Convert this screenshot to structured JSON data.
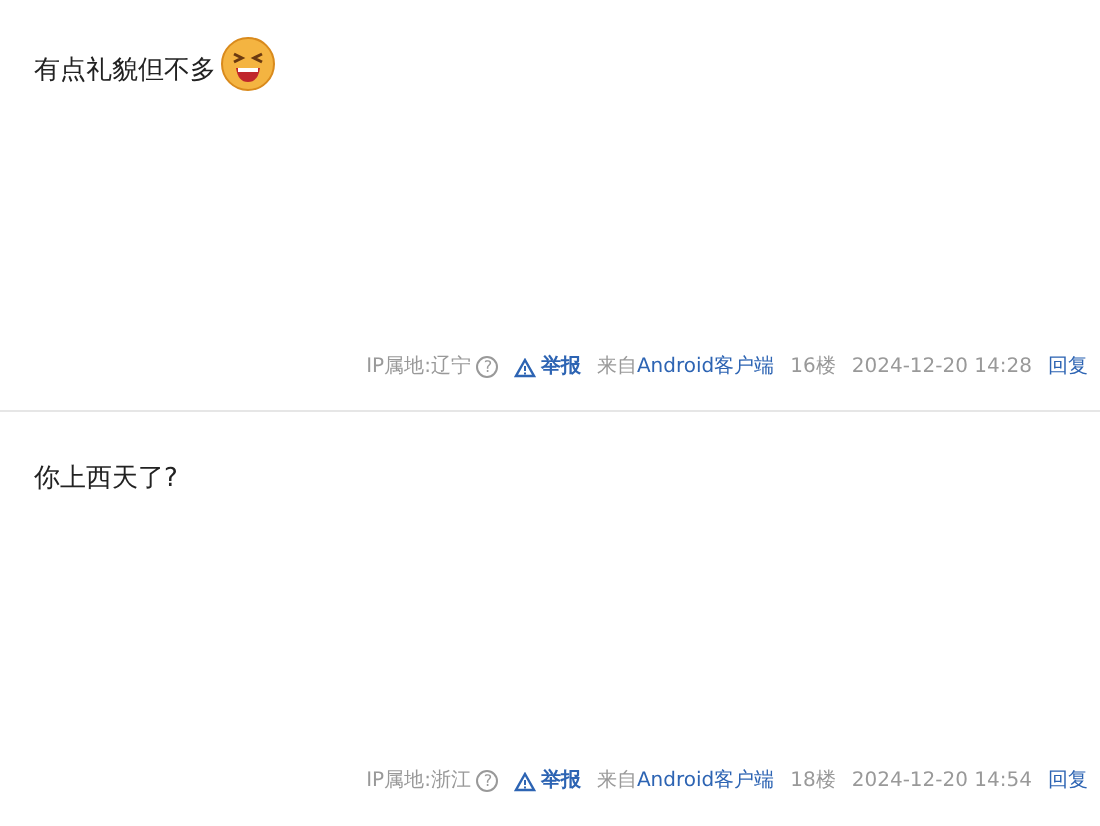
{
  "posts": [
    {
      "content": "有点礼貌但不多",
      "emoji": true,
      "ip_location": "IP属地:辽宁",
      "help": "?",
      "report": "举报",
      "source_prefix": "来自",
      "source_link": "Android客户端",
      "floor": "16楼",
      "time": "2024-12-20 14:28",
      "reply": "回复"
    },
    {
      "content": "你上西天了?",
      "emoji": false,
      "ip_location": "IP属地:浙江",
      "help": "?",
      "report": "举报",
      "source_prefix": "来自",
      "source_link": "Android客户端",
      "floor": "18楼",
      "time": "2024-12-20 14:54",
      "reply": "回复"
    }
  ]
}
